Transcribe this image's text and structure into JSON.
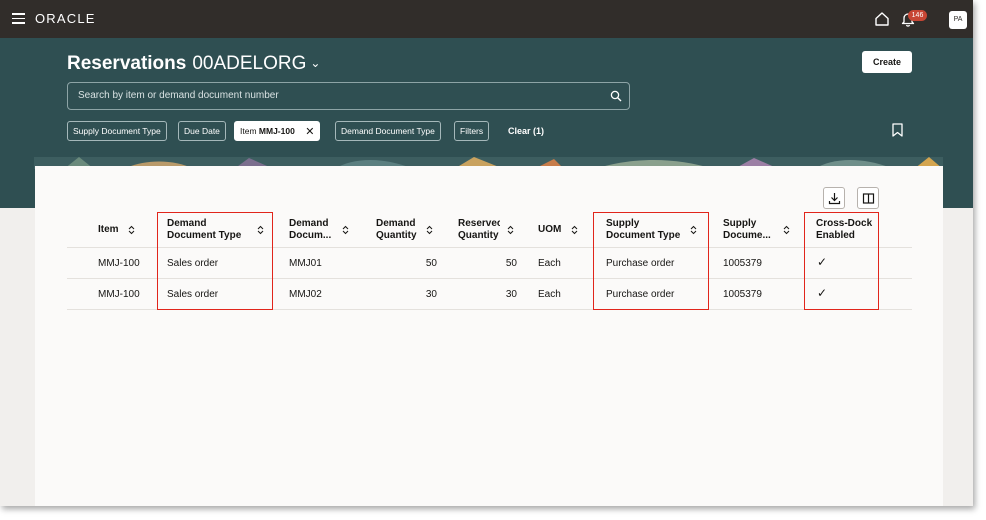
{
  "topbar": {
    "logo": "ORACLE",
    "notification_count": "146",
    "avatar_initials": "PA"
  },
  "header": {
    "title": "Reservations",
    "org": "00ADELORG",
    "create_label": "Create"
  },
  "search": {
    "placeholder": "Search by item or demand document number"
  },
  "filters": {
    "chips": [
      "Supply Document Type",
      "Due Date",
      "Item",
      "Demand Document Type",
      "Filters"
    ],
    "active_chip_prefix": "Item",
    "active_chip_value": "MMJ-100",
    "clear_label": "Clear (1)"
  },
  "table": {
    "columns": [
      [
        "Item"
      ],
      [
        "Demand",
        "Document Type"
      ],
      [
        "Demand",
        "Docum..."
      ],
      [
        "Demand",
        "Quantity"
      ],
      [
        "Reservec",
        "Quantity"
      ],
      [
        "UOM"
      ],
      [
        "Supply",
        "Document Type"
      ],
      [
        "Supply",
        "Docume..."
      ],
      [
        "Cross-Dock",
        "Enabled"
      ]
    ],
    "rows": [
      {
        "item": "MMJ-100",
        "demand_doc_type": "Sales order",
        "demand_doc": "MMJ01",
        "demand_qty": "50",
        "reserved_qty": "50",
        "uom": "Each",
        "supply_doc_type": "Purchase order",
        "supply_doc": "1005379",
        "cross_dock": "✓"
      },
      {
        "item": "MMJ-100",
        "demand_doc_type": "Sales order",
        "demand_doc": "MMJ02",
        "demand_qty": "30",
        "reserved_qty": "30",
        "uom": "Each",
        "supply_doc_type": "Purchase order",
        "supply_doc": "1005379",
        "cross_dock": "✓"
      }
    ]
  },
  "colors": {
    "topbar": "#312d2a",
    "header_band": "#2f4f52",
    "highlight": "#e1251b",
    "badge": "#c74634"
  }
}
